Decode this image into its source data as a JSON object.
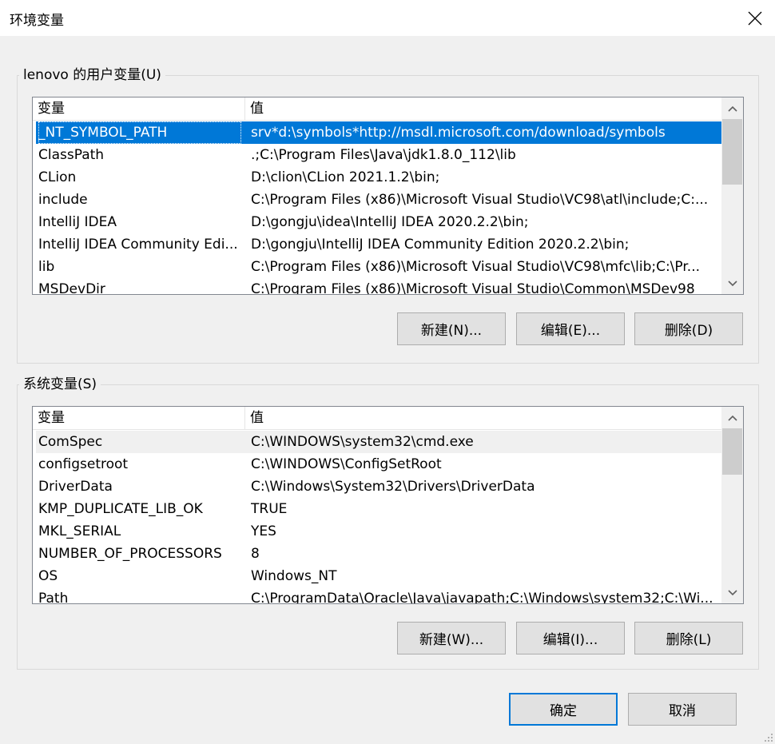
{
  "window": {
    "title": "环境变量",
    "close_icon": "close-icon"
  },
  "user_vars": {
    "group_label": "lenovo 的用户变量(U)",
    "col_name": "变量",
    "col_value": "值",
    "rows": [
      {
        "name": "_NT_SYMBOL_PATH",
        "value": "srv*d:\\symbols*http://msdl.microsoft.com/download/symbols"
      },
      {
        "name": "ClassPath",
        "value": ".;C:\\Program Files\\Java\\jdk1.8.0_112\\lib"
      },
      {
        "name": "CLion",
        "value": "D:\\clion\\CLion 2021.1.2\\bin;"
      },
      {
        "name": "include",
        "value": "C:\\Program Files (x86)\\Microsoft Visual Studio\\VC98\\atl\\include;C:..."
      },
      {
        "name": "IntelliJ IDEA",
        "value": "D:\\gongju\\idea\\IntelliJ IDEA 2020.2.2\\bin;"
      },
      {
        "name": "IntelliJ IDEA Community Edi...",
        "value": "D:\\gongju\\IntelliJ IDEA Community Edition 2020.2.2\\bin;"
      },
      {
        "name": "lib",
        "value": "C:\\Program Files (x86)\\Microsoft Visual Studio\\VC98\\mfc\\lib;C:\\Pr..."
      },
      {
        "name": "MSDevDir",
        "value": "C:\\Program Files (x86)\\Microsoft Visual Studio\\Common\\MSDev98"
      }
    ],
    "buttons": {
      "new": "新建(N)...",
      "edit": "编辑(E)...",
      "delete": "删除(D)"
    }
  },
  "system_vars": {
    "group_label": "系统变量(S)",
    "col_name": "变量",
    "col_value": "值",
    "rows": [
      {
        "name": "ComSpec",
        "value": "C:\\WINDOWS\\system32\\cmd.exe"
      },
      {
        "name": "configsetroot",
        "value": "C:\\WINDOWS\\ConfigSetRoot"
      },
      {
        "name": "DriverData",
        "value": "C:\\Windows\\System32\\Drivers\\DriverData"
      },
      {
        "name": "KMP_DUPLICATE_LIB_OK",
        "value": "TRUE"
      },
      {
        "name": "MKL_SERIAL",
        "value": "YES"
      },
      {
        "name": "NUMBER_OF_PROCESSORS",
        "value": "8"
      },
      {
        "name": "OS",
        "value": "Windows_NT"
      },
      {
        "name": "Path",
        "value": "C:\\ProgramData\\Oracle\\Java\\javapath;C:\\Windows\\system32;C:\\Wi..."
      }
    ],
    "buttons": {
      "new": "新建(W)...",
      "edit": "编辑(I)...",
      "delete": "删除(L)"
    }
  },
  "footer": {
    "ok": "确定",
    "cancel": "取消"
  },
  "colors": {
    "selection": "#0078d7",
    "default_button_border": "#0078d7"
  }
}
